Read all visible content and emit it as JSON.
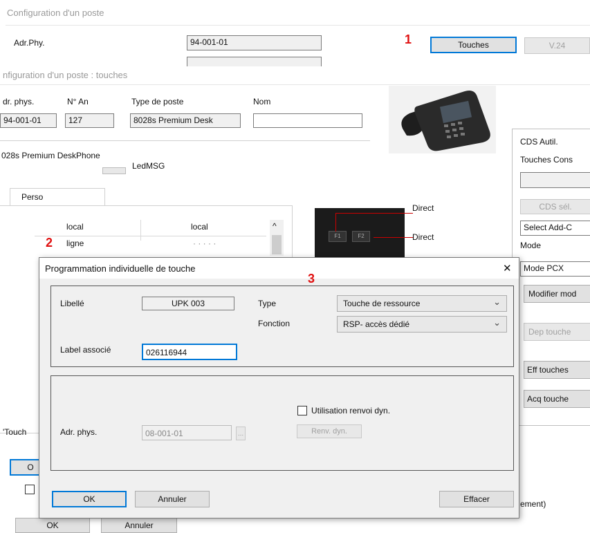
{
  "back_window": {
    "title": "Configuration d'un poste",
    "adr_phy_label": "Adr.Phy.",
    "adr_phy_value": "94-001-01",
    "touches_button": "Touches",
    "v24_button": "V.24"
  },
  "markers": {
    "m1": "1",
    "m2": "2",
    "m3": "3"
  },
  "mid_window": {
    "title": "nfiguration d'un poste : touches",
    "col_adr": "dr. phys.",
    "col_nan": "N° An",
    "col_type": "Type de poste",
    "col_nom": "Nom",
    "adr_value": "94-001-01",
    "nan_value": "127",
    "type_value": "8028s Premium Desk",
    "nom_value": "",
    "phone_model": "028s Premium DeskPhone",
    "led_label": "LedMSG",
    "tab_label": "Perso",
    "table_rows": [
      {
        "c1": "local",
        "c2": "local"
      },
      {
        "c1": "ligne",
        "c2": "· · · · ·"
      }
    ],
    "direct_1": "Direct",
    "direct_2": "Direct",
    "key_f1": "F1",
    "key_f2": "F2",
    "touch_label": "'Touch",
    "o_button": "O",
    "ok_button": "OK",
    "annuler_button": "Annuler",
    "right_cds_autil": "CDS  Autil.",
    "right_touches_cons": "Touches Cons",
    "right_cds_sel": "CDS sél.",
    "right_select_add": "Select Add-C",
    "right_mode": "Mode",
    "right_mode_pcx": "Mode PCX",
    "right_modifier": "Modifier mod",
    "right_dep": "Dep touche",
    "right_eff": "Eff touches",
    "right_acq": "Acq touche",
    "right_ement": "ement)"
  },
  "dialog": {
    "title": "Programmation individuelle de touche",
    "close_glyph": "✕",
    "libelle_label": "Libellé",
    "libelle_value": "UPK 003",
    "type_label": "Type",
    "type_value": "Touche de ressource",
    "fonction_label": "Fonction",
    "fonction_value": "RSP- accès dédié",
    "label_associe_label": "Label associé",
    "label_associe_value": "026116944",
    "checkbox_label": "Utilisation renvoi dyn.",
    "adr_phys_label": "Adr. phys.",
    "adr_phys_value": "08-001-01",
    "browse_glyph": "...",
    "renv_button": "Renv. dyn.",
    "ok_button": "OK",
    "annuler_button": "Annuler",
    "effacer_button": "Effacer"
  },
  "colors": {
    "marker_red": "#e01010",
    "ok_border": "#0078d7",
    "active_input_border": "#0078d7"
  }
}
